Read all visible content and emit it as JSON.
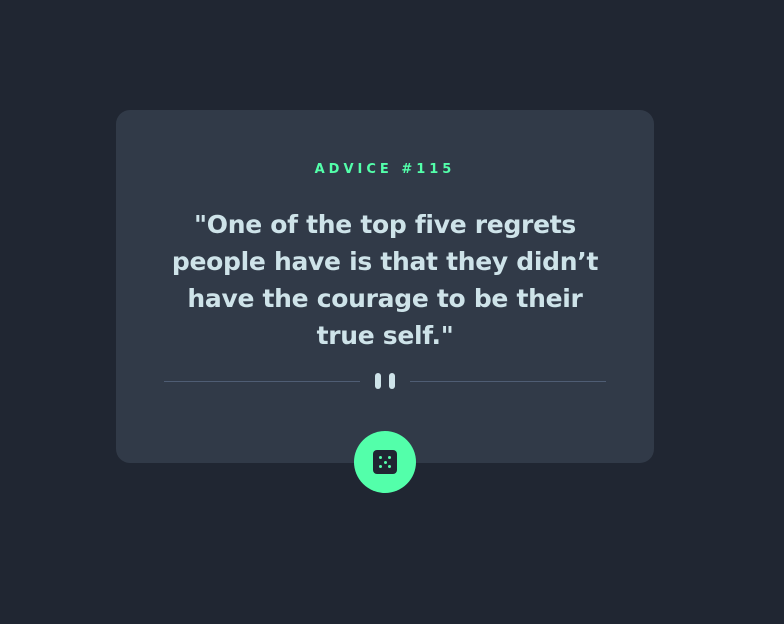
{
  "card": {
    "advice_id": "ADVICE #115",
    "quote": "\"One of the top five regrets people have is that they didn’t have the courage to be their true self.\""
  },
  "icons": {
    "divider": "pause-icon",
    "button": "dice-icon"
  },
  "colors": {
    "background": "#202632",
    "card": "#313a48",
    "accent": "#53ffaa",
    "text": "#cee3e9",
    "divider": "#4f5d74"
  }
}
